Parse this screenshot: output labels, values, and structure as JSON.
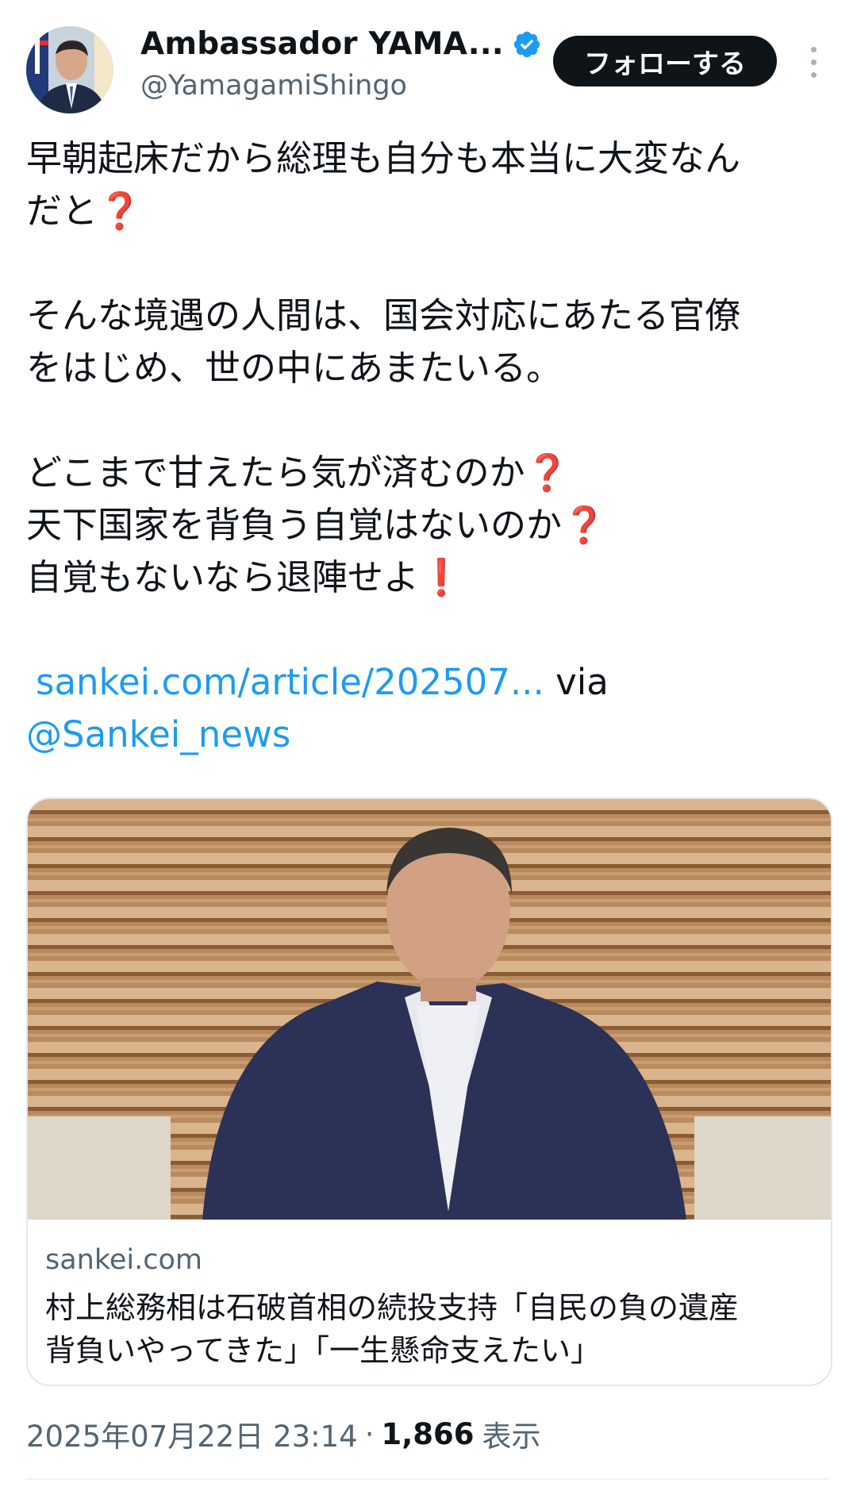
{
  "author": {
    "display_name": "Ambassador YAMA...",
    "handle": "@YamagamiShingo",
    "verified": true
  },
  "header": {
    "follow_label": "フォローする"
  },
  "tweet": {
    "p1_line1": "早朝起床だから総理も自分も本当に大変なん",
    "p1_line2": "だと",
    "p2_line1": "そんな境遇の人間は、国会対応にあたる官僚",
    "p2_line2": "をはじめ、世の中にあまたいる。",
    "p3_line1": "どこまで甘えたら気が済むのか",
    "p3_line2": "天下国家を背負う自覚はないのか",
    "p3_line3": "自覚もないなら退陣せよ",
    "question_mark": "❓",
    "exclamation_mark": "❗",
    "link_text": "sankei.com/article/202507...",
    "via": " via",
    "mention": "@Sankei_news"
  },
  "card": {
    "domain": "sankei.com",
    "title_line1": "村上総務相は石破首相の続投支持「自民の負の遺産",
    "title_line2": "背負いやってきた」「一生懸命支えたい」"
  },
  "meta": {
    "timestamp": "2025年07月22日 23:14",
    "separator": "·",
    "views_count": "1,866",
    "views_label": "表示"
  },
  "colors": {
    "link": "#1d9bf0",
    "verified": "#1d9bf0",
    "mark": "#e0245e"
  },
  "icons": [
    "verified-badge-icon",
    "more-dots-icon"
  ]
}
